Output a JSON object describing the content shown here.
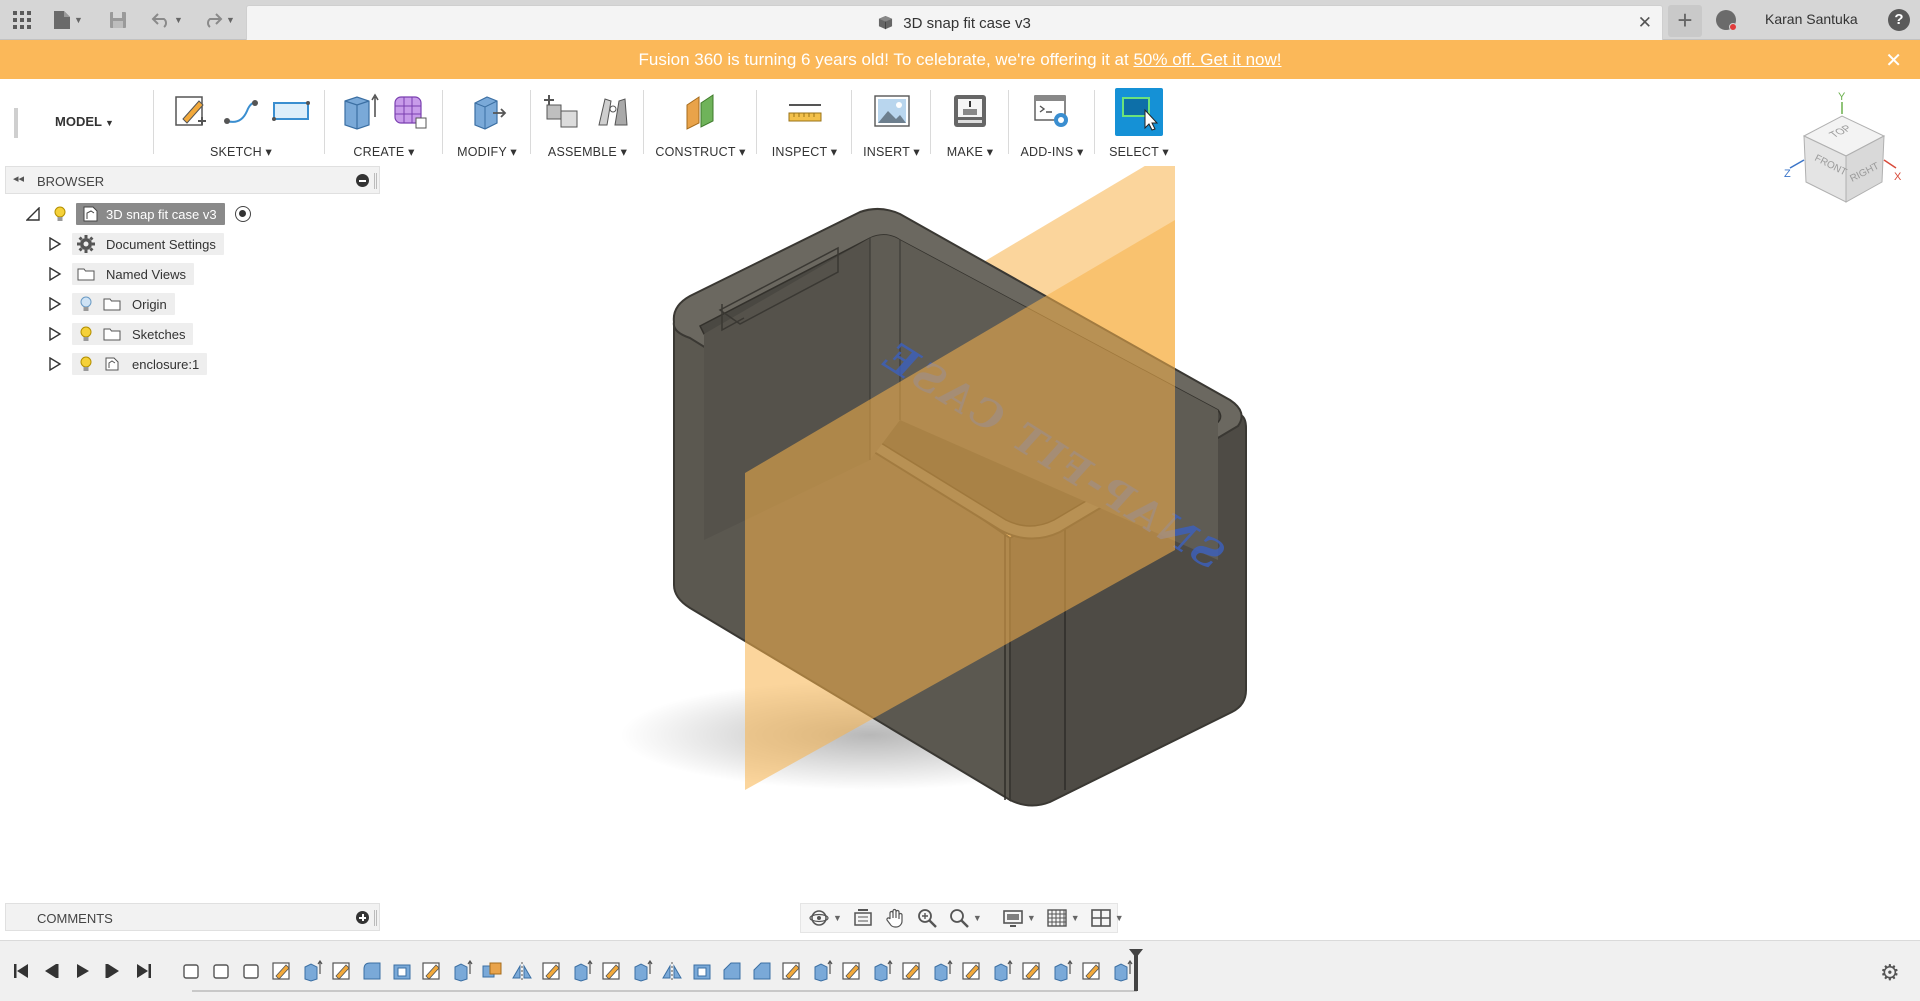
{
  "titlebar": {
    "document_title": "3D snap fit case v3",
    "user_name": "Karan Santuka",
    "help_label": "?",
    "close_tab": "✕",
    "new_tab": "+"
  },
  "banner": {
    "text": "Fusion 360 is turning 6 years old! To celebrate, we're offering it at ",
    "link_text": "50% off. Get it now!",
    "close": "✕"
  },
  "toolbar": {
    "workspace_label": "MODEL",
    "groups": [
      {
        "label": "SKETCH"
      },
      {
        "label": "CREATE"
      },
      {
        "label": "MODIFY"
      },
      {
        "label": "ASSEMBLE"
      },
      {
        "label": "CONSTRUCT"
      },
      {
        "label": "INSPECT"
      },
      {
        "label": "INSERT"
      },
      {
        "label": "MAKE"
      },
      {
        "label": "ADD-INS"
      },
      {
        "label": "SELECT"
      }
    ]
  },
  "browser": {
    "title": "BROWSER",
    "root": "3D snap fit case v3",
    "items": [
      {
        "label": "Document Settings",
        "icon": "gear-icon"
      },
      {
        "label": "Named Views",
        "icon": "folder-icon"
      },
      {
        "label": "Origin",
        "icon": "folder-icon"
      },
      {
        "label": "Sketches",
        "icon": "folder-icon"
      },
      {
        "label": "enclosure:1",
        "icon": "component-icon"
      }
    ]
  },
  "viewport": {
    "model_text": "SNAP-FIT CASE",
    "viewcube": {
      "top": "TOP",
      "front": "FRONT",
      "right": "RIGHT",
      "x": "X",
      "y": "Y",
      "z": "Z"
    }
  },
  "comments": {
    "title": "COMMENTS"
  },
  "colors": {
    "banner": "#fbb859",
    "accent": "#1591d6",
    "plane": "#f8b24a",
    "body": "#5d5a53"
  }
}
